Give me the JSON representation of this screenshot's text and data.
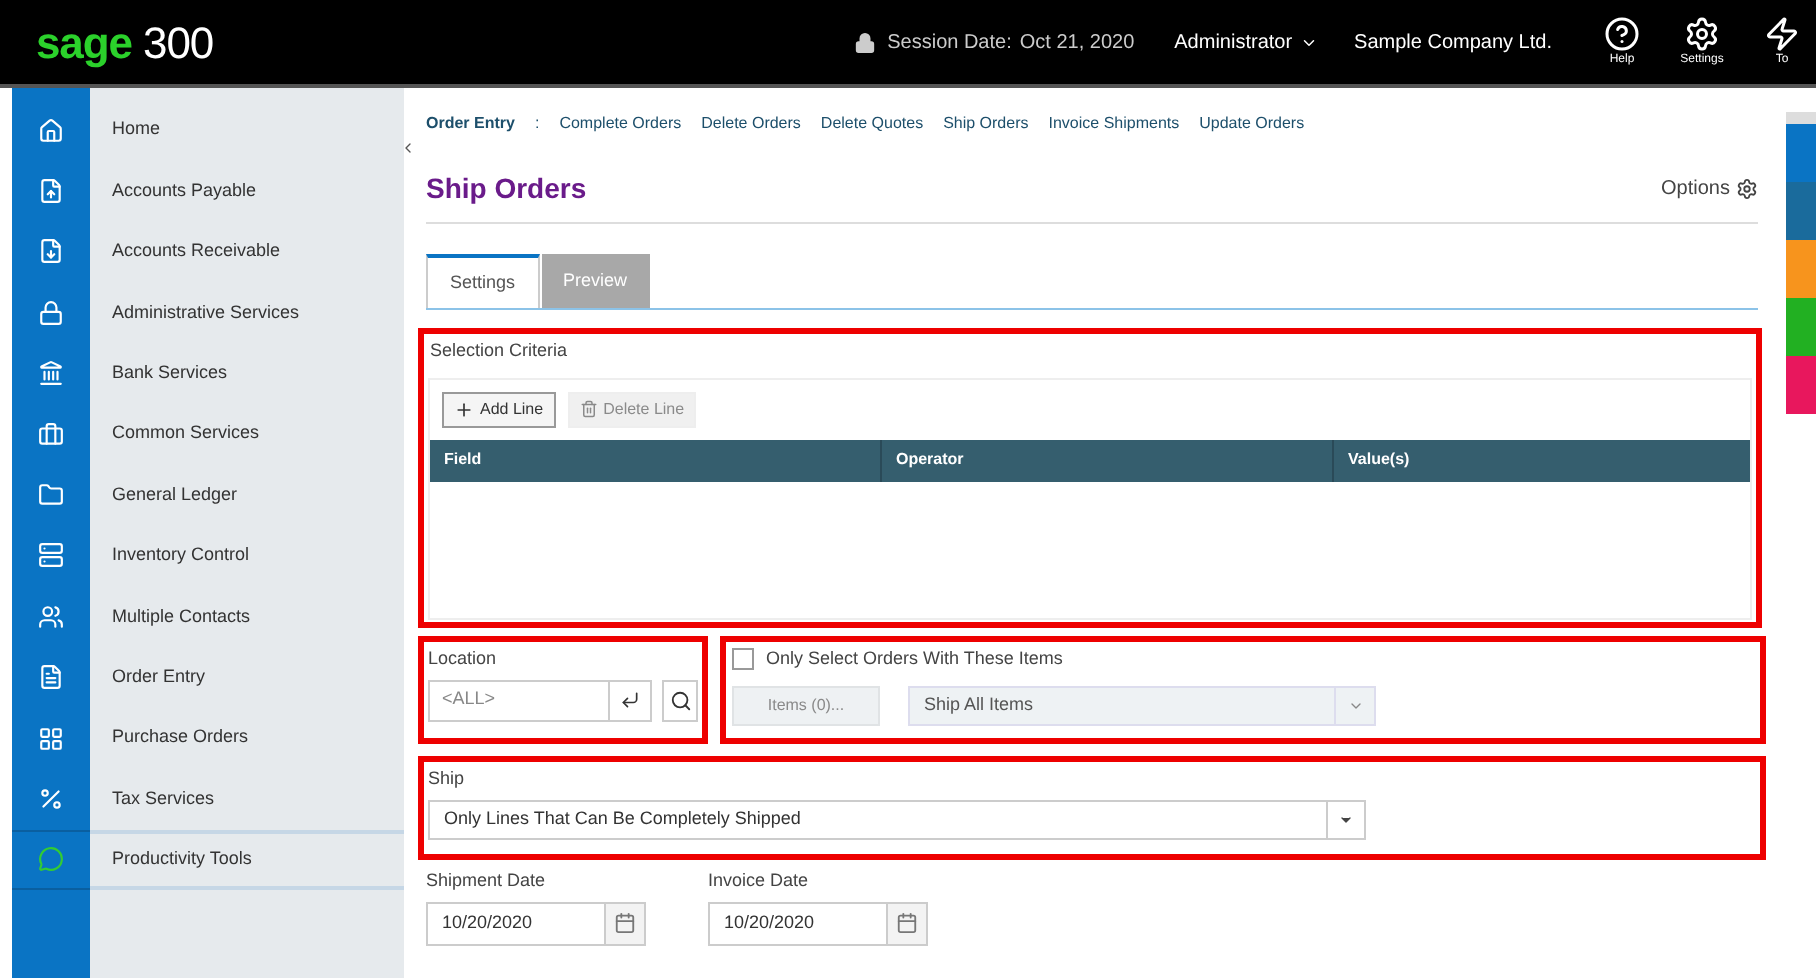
{
  "header": {
    "logo_brand": "sage",
    "logo_number": "300",
    "session_label": "Session Date:",
    "session_date": "Oct 21, 2020",
    "user": "Administrator",
    "company": "Sample Company Ltd.",
    "tools": [
      {
        "kind": "help",
        "label": "Help"
      },
      {
        "kind": "settings",
        "label": "Settings"
      },
      {
        "kind": "tools",
        "label": "To"
      }
    ]
  },
  "sidebar": {
    "items": [
      {
        "kind": "module",
        "label": "Home"
      },
      {
        "kind": "module",
        "label": "Accounts Payable"
      },
      {
        "kind": "module",
        "label": "Accounts Receivable"
      },
      {
        "kind": "module",
        "label": "Administrative Services"
      },
      {
        "kind": "module",
        "label": "Bank Services"
      },
      {
        "kind": "module",
        "label": "Common Services"
      },
      {
        "kind": "module",
        "label": "General Ledger"
      },
      {
        "kind": "module",
        "label": "Inventory Control"
      },
      {
        "kind": "module",
        "label": "Multiple Contacts"
      },
      {
        "kind": "module",
        "label": "Order Entry"
      },
      {
        "kind": "module",
        "label": "Purchase Orders"
      },
      {
        "kind": "module",
        "label": "Tax Services"
      },
      {
        "kind": "tools",
        "label": "Productivity Tools"
      }
    ]
  },
  "breadcrumb": {
    "module": "Order Entry",
    "separator": ":",
    "links": [
      "Complete Orders",
      "Delete Orders",
      "Delete Quotes",
      "Ship Orders",
      "Invoice Shipments",
      "Update Orders"
    ]
  },
  "page": {
    "title": "Ship Orders",
    "options": "Options"
  },
  "tabs": [
    {
      "label": "Settings",
      "selected": true
    },
    {
      "label": "Preview",
      "selected": false
    }
  ],
  "selection_criteria": {
    "title": "Selection Criteria",
    "buttons": [
      {
        "kind": "add",
        "label": "Add Line",
        "disabled": false
      },
      {
        "kind": "delete",
        "label": "Delete Line",
        "disabled": true
      }
    ],
    "columns": [
      "Field",
      "Operator",
      "Value(s)"
    ]
  },
  "location": {
    "label": "Location",
    "placeholder": "<ALL>"
  },
  "only_select": {
    "label": "Only Select Orders With These Items",
    "checked": false,
    "items_button": {
      "label": "Items (0)...",
      "disabled": true
    },
    "select": {
      "value": "Ship All Items",
      "disabled": true
    }
  },
  "ship": {
    "label": "Ship",
    "value": "Only Lines That Can Be Completely Shipped"
  },
  "dates": [
    {
      "label": "Shipment Date",
      "value": "10/20/2020"
    },
    {
      "label": "Invoice Date",
      "value": "10/20/2020"
    }
  ],
  "dock": [
    {
      "color": "#0a74c4"
    },
    {
      "color": "#1a6b9c"
    },
    {
      "color": "#f7941d"
    },
    {
      "color": "#22b022"
    },
    {
      "color": "#e8175d"
    }
  ]
}
